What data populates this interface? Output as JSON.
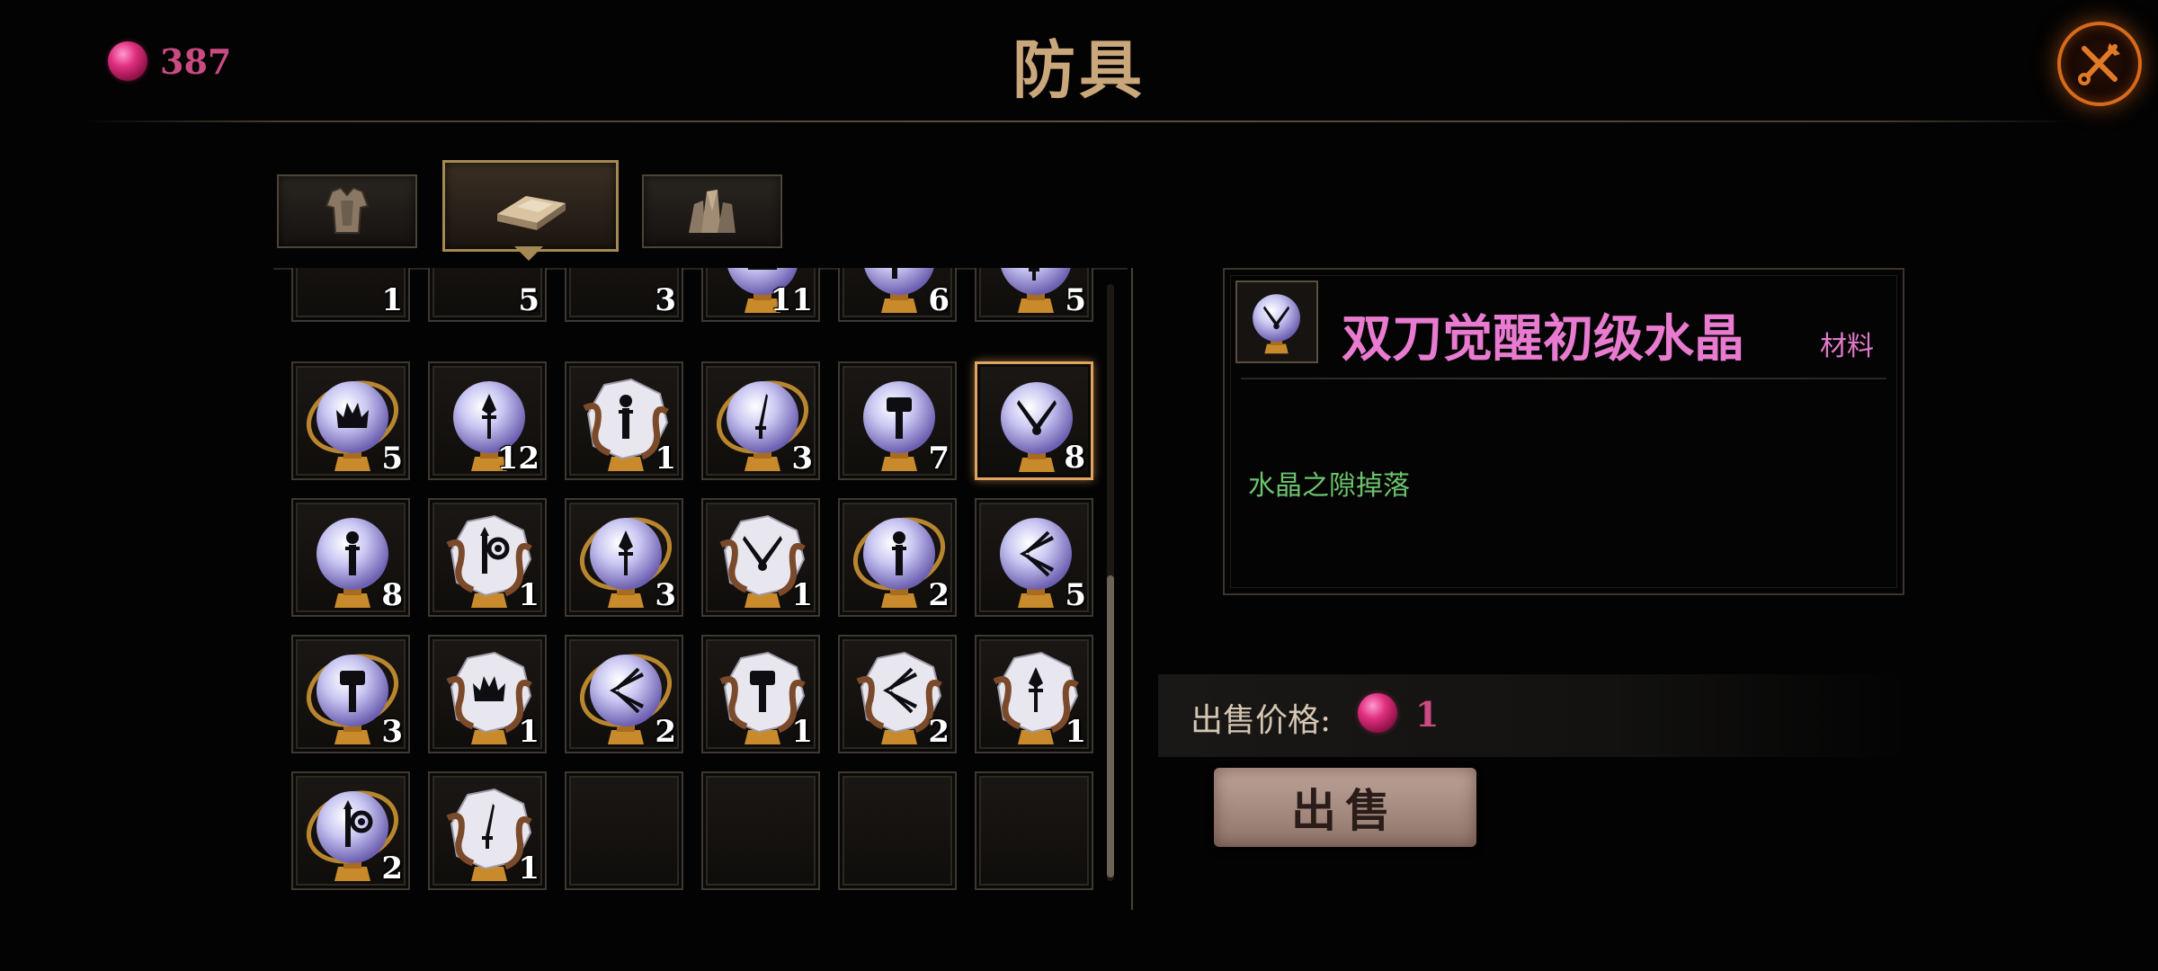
{
  "header": {
    "currency_amount": "387",
    "title": "防具"
  },
  "tabs": [
    {
      "name": "armor-tab",
      "icon": "armor-icon"
    },
    {
      "name": "material-tab",
      "icon": "ingot-icon",
      "active": true
    },
    {
      "name": "crystal-tab",
      "icon": "crystal-cluster-icon"
    }
  ],
  "inventory": {
    "rows": [
      [
        {
          "icon": "purple-helm-gem",
          "count": "1"
        },
        {
          "icon": "red-gem",
          "count": "5"
        },
        {
          "icon": "blue-gem",
          "count": "3"
        },
        {
          "icon": "orb-crown",
          "count": "11"
        },
        {
          "icon": "orb-mace",
          "count": "6"
        },
        {
          "icon": "orb-blade",
          "count": "5"
        }
      ],
      [
        {
          "icon": "orb-ring-crown",
          "count": "5"
        },
        {
          "icon": "orb-spear",
          "count": "12"
        },
        {
          "icon": "rock-staff",
          "count": "1"
        },
        {
          "icon": "orb-ring-blade",
          "count": "3"
        },
        {
          "icon": "orb-hammer",
          "count": "7"
        },
        {
          "icon": "orb-dual-blades",
          "count": "8",
          "selected": true
        }
      ],
      [
        {
          "icon": "orb-staff",
          "count": "8"
        },
        {
          "icon": "rock-mace",
          "count": "1"
        },
        {
          "icon": "orb-ring-spear",
          "count": "3"
        },
        {
          "icon": "rock-dual-blades",
          "count": "1"
        },
        {
          "icon": "orb-ring-staff",
          "count": "2"
        },
        {
          "icon": "orb-bow",
          "count": "5"
        }
      ],
      [
        {
          "icon": "orb-ring-hammer",
          "count": "3"
        },
        {
          "icon": "rock-crown",
          "count": "1"
        },
        {
          "icon": "orb-ring-bow",
          "count": "2"
        },
        {
          "icon": "rock-hammer",
          "count": "1"
        },
        {
          "icon": "rock-bow",
          "count": "2"
        },
        {
          "icon": "rock-spear",
          "count": "1"
        }
      ],
      [
        {
          "icon": "orb-ring-mace",
          "count": "2"
        },
        {
          "icon": "rock-blade",
          "count": "1"
        },
        {
          "icon": "",
          "count": ""
        },
        {
          "icon": "",
          "count": ""
        },
        {
          "icon": "",
          "count": ""
        },
        {
          "icon": "",
          "count": ""
        }
      ]
    ]
  },
  "detail": {
    "item_name": "双刀觉醒初级水晶",
    "category": "材料",
    "source": "水晶之隙掉落"
  },
  "sale": {
    "price_label": "出售价格:",
    "price_value": "1",
    "sell_button_label": "出售"
  },
  "colors": {
    "gem": "#d8307a",
    "selected_border": "#e0a360",
    "item_name": "#e87ad0",
    "source_text": "#6cc36c",
    "close_ring": "#d86a1c"
  }
}
